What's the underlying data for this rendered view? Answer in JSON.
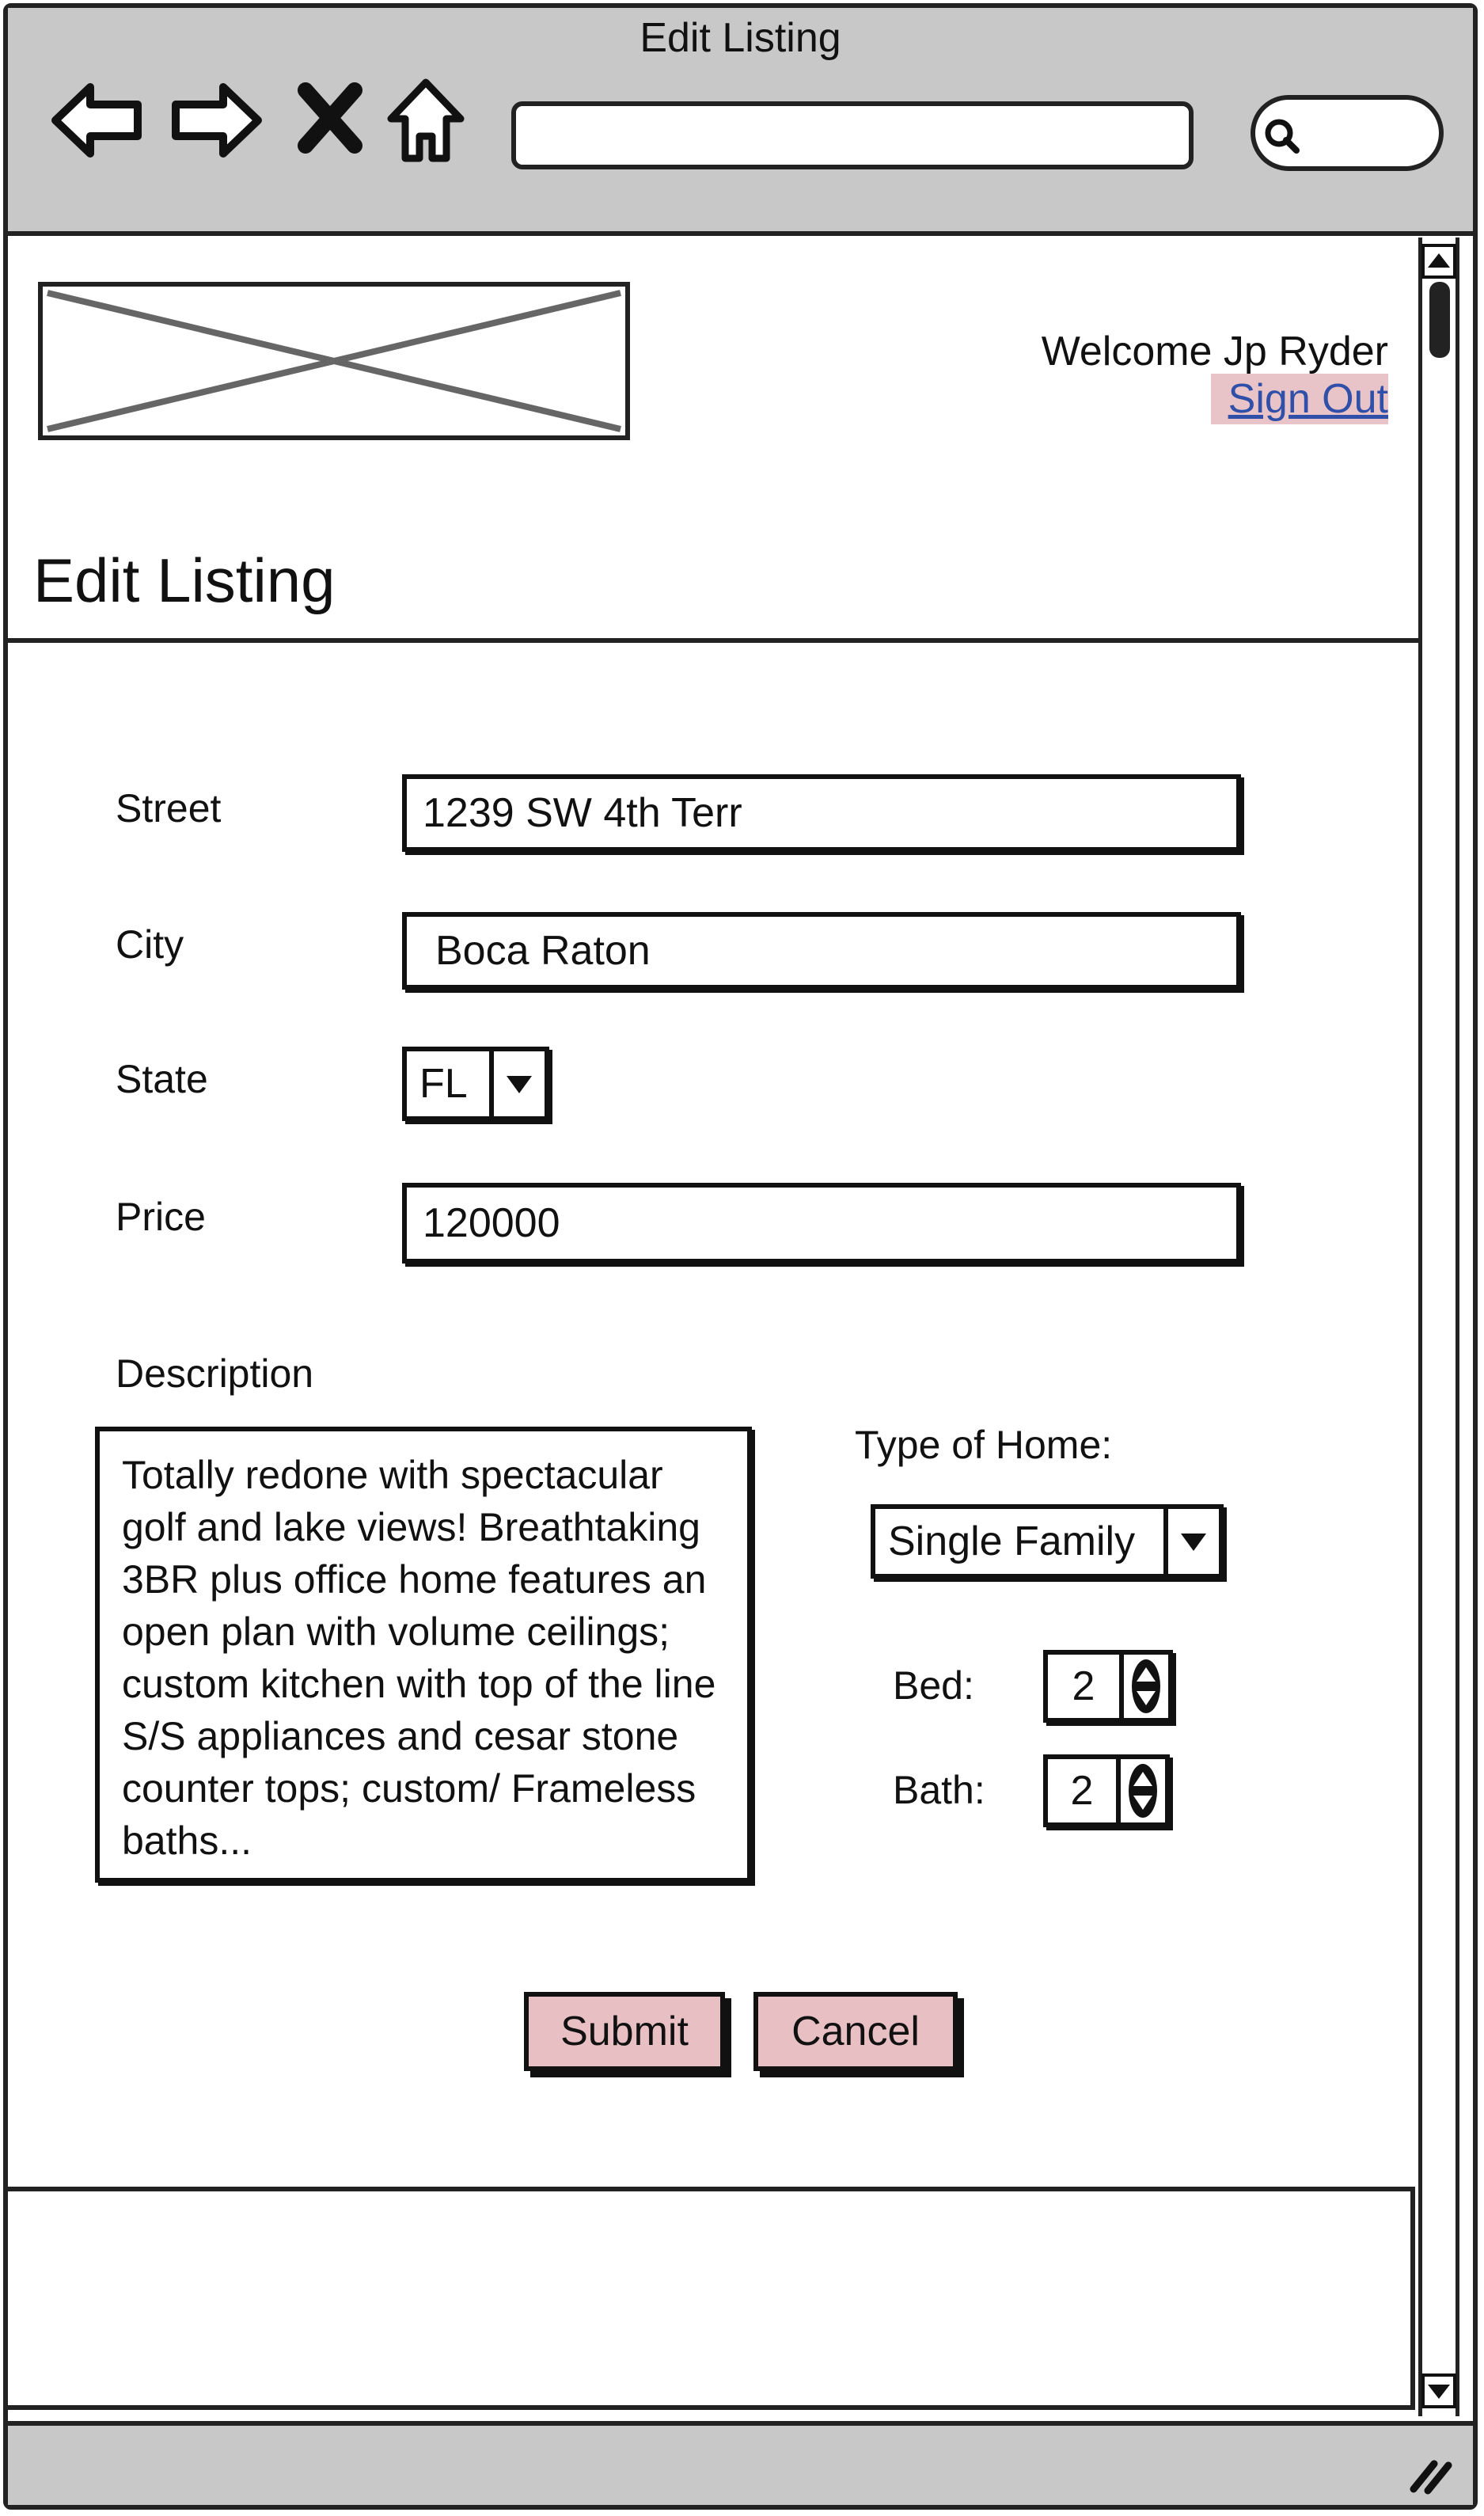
{
  "browser": {
    "title": "Edit Listing",
    "url_value": "",
    "search_value": ""
  },
  "header": {
    "welcome_text": "Welcome Jp Ryder",
    "sign_out_label": "Sign Out"
  },
  "page": {
    "title": "Edit Listing"
  },
  "form": {
    "street": {
      "label": "Street",
      "value": "1239 SW 4th Terr"
    },
    "city": {
      "label": "City",
      "value": "Boca Raton"
    },
    "state": {
      "label": "State",
      "value": "FL"
    },
    "price": {
      "label": "Price",
      "value": "120000"
    },
    "description": {
      "label": "Description",
      "value": "Totally redone with spectacular golf and lake views! Breathtaking 3BR plus office home features an open plan with volume ceilings; custom kitchen with top of the line S/S appliances and cesar stone counter tops; custom/ Frameless baths..."
    },
    "home_type": {
      "label": "Type of Home:",
      "value": "Single Family"
    },
    "bed": {
      "label": "Bed:",
      "value": "2"
    },
    "bath": {
      "label": "Bath:",
      "value": "2"
    },
    "submit_label": "Submit",
    "cancel_label": "Cancel"
  },
  "colors": {
    "chrome": "#c8c8c8",
    "button_fill": "#e8c0c4",
    "link": "#2f4fa8"
  },
  "icons": [
    "back-arrow-icon",
    "forward-arrow-icon",
    "stop-icon",
    "home-icon",
    "search-icon",
    "scroll-up-icon",
    "scroll-down-icon",
    "resize-grip-icon",
    "chevron-down-icon",
    "stepper-arrows-icon",
    "image-placeholder-icon"
  ]
}
